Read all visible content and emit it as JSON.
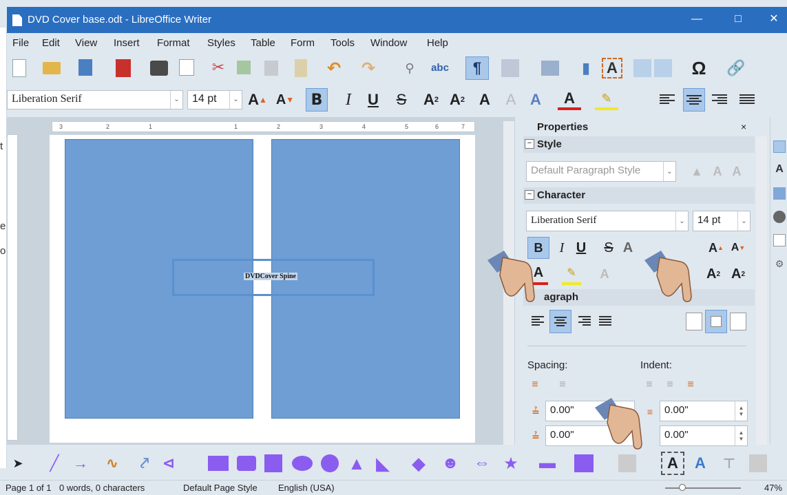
{
  "window": {
    "title": "DVD Cover base.odt - LibreOffice Writer",
    "minimize": "—",
    "maximize": "□",
    "close": "✕"
  },
  "left_strip": [
    "t",
    "e",
    "o"
  ],
  "menu": [
    "File",
    "Edit",
    "View",
    "Insert",
    "Format",
    "Styles",
    "Table",
    "Form",
    "Tools",
    "Window",
    "Help"
  ],
  "format_toolbar": {
    "font_name": "Liberation Serif",
    "font_size": "14 pt",
    "bold": "B",
    "italic": "I",
    "underline": "U"
  },
  "document": {
    "ruler_numbers": [
      "3",
      "2",
      "1",
      "1",
      "2",
      "3",
      "4",
      "5",
      "6",
      "7"
    ],
    "spine_text": "DVDCover Spine"
  },
  "sidebar": {
    "title": "Properties",
    "close": "×",
    "style_section": "Style",
    "paragraph_style": "Default Paragraph Style",
    "character_section": "Character",
    "font_name": "Liberation Serif",
    "font_size": "14 pt",
    "bold": "B",
    "italic": "I",
    "underline": "U",
    "paragraph_section": "agraph",
    "spacing_label": "Spacing:",
    "indent_label": "Indent:",
    "spacing_above": "0.00\"",
    "spacing_below": "0.00\"",
    "indent_before": "0.00\"",
    "indent_after": "0.00\""
  },
  "status": {
    "page": "Page 1 of 1",
    "words": "0 words, 0 characters",
    "page_style": "Default Page Style",
    "language": "English (USA)",
    "zoom": "47%"
  },
  "colors": {
    "titlebar": "#2a6ec0",
    "panel_fill": "#6e9ed4",
    "toolbar_bg": "#dfe7ef",
    "shape_purple": "#8b5cf0"
  }
}
